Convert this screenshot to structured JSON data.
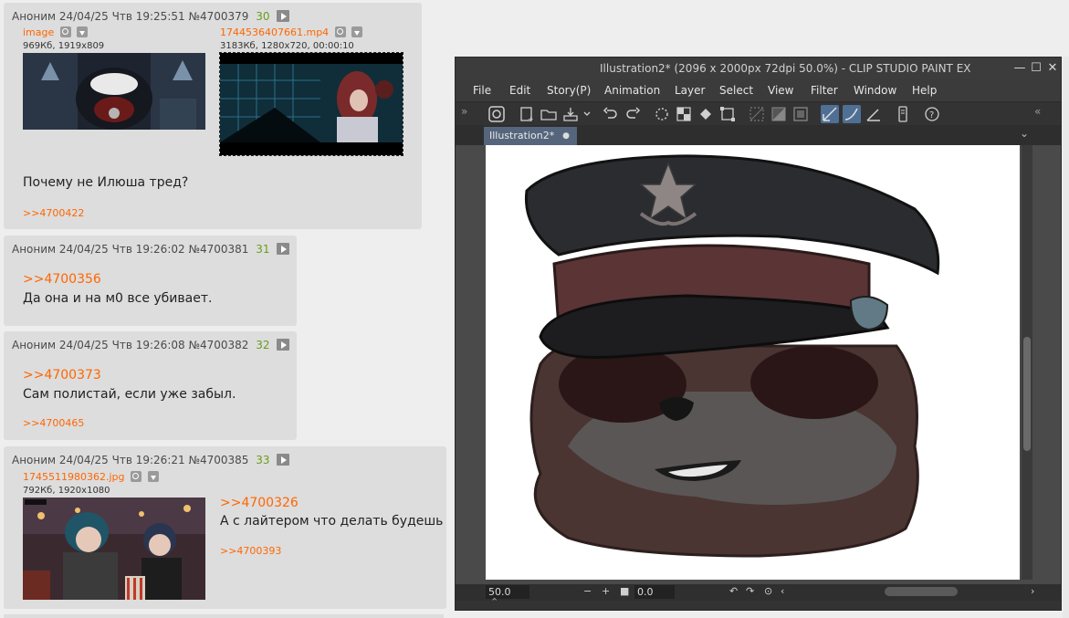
{
  "posts": [
    {
      "author": "Аноним",
      "date": "24/04/25 Чтв 19:25:51",
      "post_no": "№4700379",
      "index": "30",
      "files": [
        {
          "name": "image",
          "meta": "969Кб, 1919x809"
        },
        {
          "name": "1744536407661.mp4",
          "meta": "3183Кб, 1280x720, 00:00:10"
        }
      ],
      "text": "Почему не Илюша тред?",
      "replies": ">>4700422"
    },
    {
      "author": "Аноним",
      "date": "24/04/25 Чтв 19:26:02",
      "post_no": "№4700381",
      "index": "31",
      "quote": ">>4700356",
      "text": "Да она и на м0 все убивает."
    },
    {
      "author": "Аноним",
      "date": "24/04/25 Чтв 19:26:08",
      "post_no": "№4700382",
      "index": "32",
      "quote": ">>4700373",
      "text": "Сам полистай, если уже забыл.",
      "replies": ">>4700465"
    },
    {
      "author": "Аноним",
      "date": "24/04/25 Чтв 19:26:21",
      "post_no": "№4700385",
      "index": "33",
      "files": [
        {
          "name": "1745511980362.jpg",
          "meta": "792Кб, 1920x1080"
        }
      ],
      "quote": ">>4700326",
      "text": "А с лайтером что делать будешь",
      "replies": ">>4700393"
    }
  ],
  "csp": {
    "title": "Illustration2* (2096 x 2000px 72dpi 50.0%)  - CLIP STUDIO PAINT EX",
    "menu": [
      "File",
      "Edit",
      "Story(P)",
      "Animation",
      "Layer",
      "Select",
      "View",
      "Filter",
      "Window",
      "Help"
    ],
    "tab": "Illustration2*",
    "tab_dot": "●",
    "zoom": "50.0",
    "rotation": "0.0",
    "minimize": "—",
    "maximize": "☐",
    "close": "✕",
    "expand_left": "»",
    "expand_right": "«",
    "collapse": "⌄",
    "expand_up": "⌃"
  },
  "colors": {
    "link": "#ff6600",
    "post_number": "#6b9b1f",
    "post_bg": "#dddddd",
    "page_bg": "#eeeeee",
    "csp_bg": "#3b3b3b",
    "csp_tab": "#55657c"
  }
}
